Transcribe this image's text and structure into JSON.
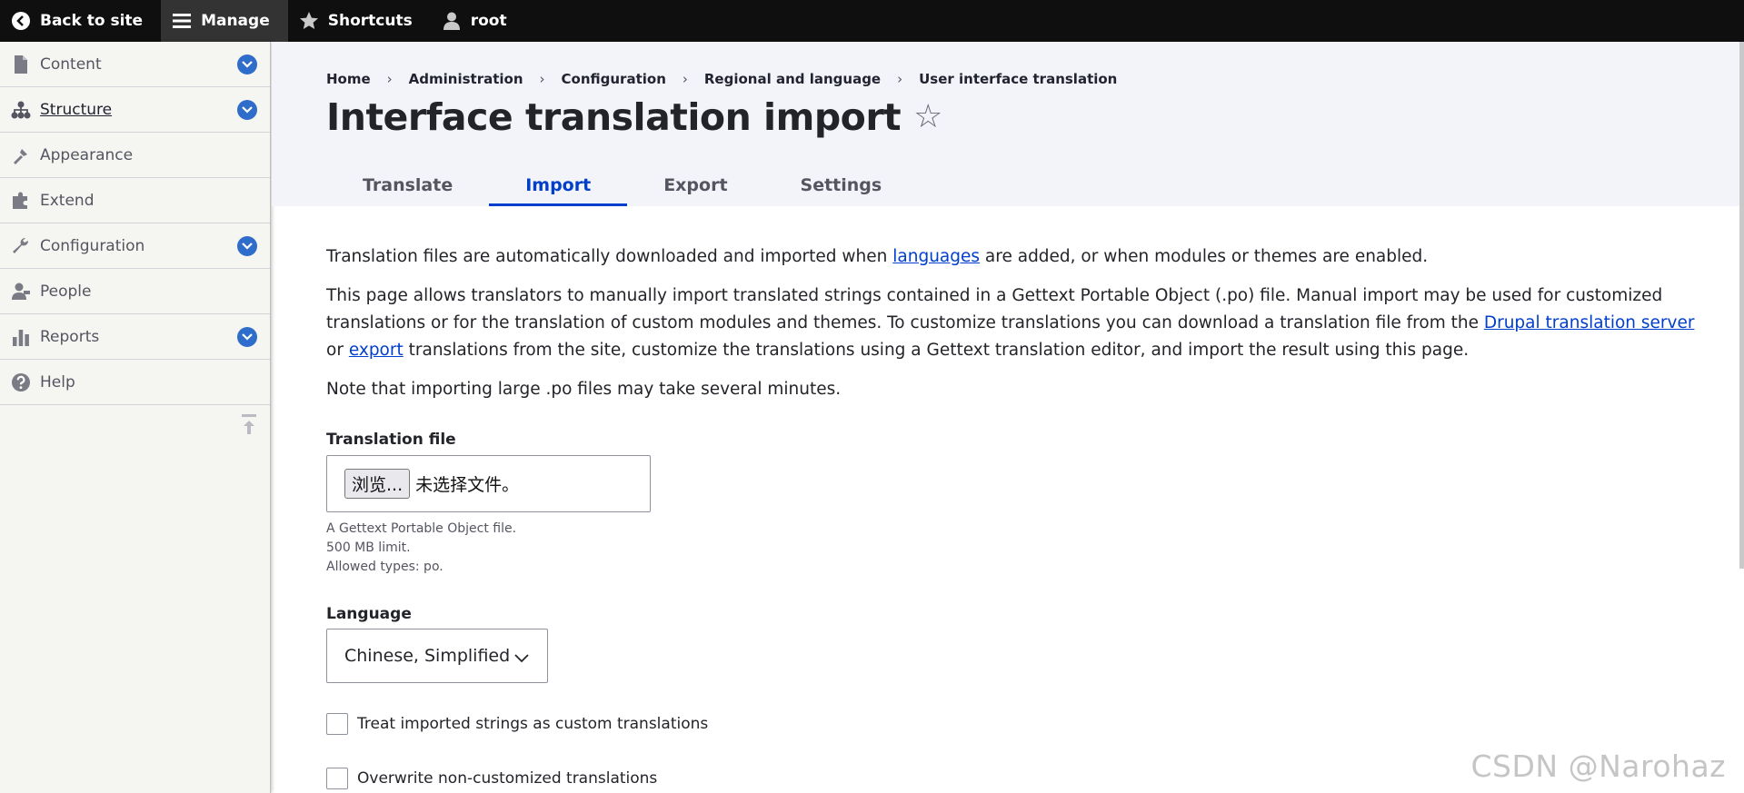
{
  "toolbar": {
    "back": {
      "label": "Back to site",
      "icon": "chevron-left-circle-icon"
    },
    "manage": {
      "label": "Manage",
      "icon": "hamburger-icon"
    },
    "shortcuts": {
      "label": "Shortcuts",
      "icon": "star-icon"
    },
    "user": {
      "label": "root",
      "icon": "user-icon"
    }
  },
  "sidebar": {
    "items": [
      {
        "label": "Content",
        "icon": "file-icon",
        "expandable": true
      },
      {
        "label": "Structure",
        "icon": "structure-icon",
        "expandable": true,
        "active": true
      },
      {
        "label": "Appearance",
        "icon": "paintbrush-icon",
        "expandable": false
      },
      {
        "label": "Extend",
        "icon": "puzzle-icon",
        "expandable": false
      },
      {
        "label": "Configuration",
        "icon": "wrench-icon",
        "expandable": true
      },
      {
        "label": "People",
        "icon": "people-icon",
        "expandable": false
      },
      {
        "label": "Reports",
        "icon": "bar-chart-icon",
        "expandable": true
      },
      {
        "label": "Help",
        "icon": "help-icon",
        "expandable": false
      }
    ]
  },
  "breadcrumb": [
    "Home",
    "Administration",
    "Configuration",
    "Regional and language",
    "User interface translation"
  ],
  "page_title": "Interface translation import",
  "tabs": [
    {
      "label": "Translate",
      "active": false
    },
    {
      "label": "Import",
      "active": true
    },
    {
      "label": "Export",
      "active": false
    },
    {
      "label": "Settings",
      "active": false
    }
  ],
  "content": {
    "p1": {
      "before": "Translation files are automatically downloaded and imported when ",
      "link": "languages",
      "after": " are added, or when modules or themes are enabled."
    },
    "p2": {
      "text1": "This page allows translators to manually import translated strings contained in a Gettext Portable Object (.po) file. Manual import may be used for customized translations or for the translation of custom modules and themes. To customize translations you can download a translation file from the ",
      "link1": "Drupal translation server",
      "text2": " or ",
      "link2": "export",
      "text3": " translations from the site, customize the translations using a Gettext translation editor, and import the result using this page."
    },
    "p3": "Note that importing large .po files may take several minutes."
  },
  "form": {
    "file": {
      "label": "Translation file",
      "browse_label": "浏览...",
      "no_file_text": "未选择文件。",
      "desc": [
        "A Gettext Portable Object file.",
        "500 MB limit.",
        "Allowed types: po."
      ]
    },
    "language": {
      "label": "Language",
      "selected": "Chinese, Simplified"
    },
    "checkbox_custom": "Treat imported strings as custom translations",
    "checkbox_overwrite": "Overwrite non-customized translations"
  },
  "watermark": "CSDN @Narohaz",
  "colors": {
    "accent": "#003ecc",
    "chevron_badge": "#2f6dcb",
    "toolbar_bg": "#0f0f0f"
  }
}
